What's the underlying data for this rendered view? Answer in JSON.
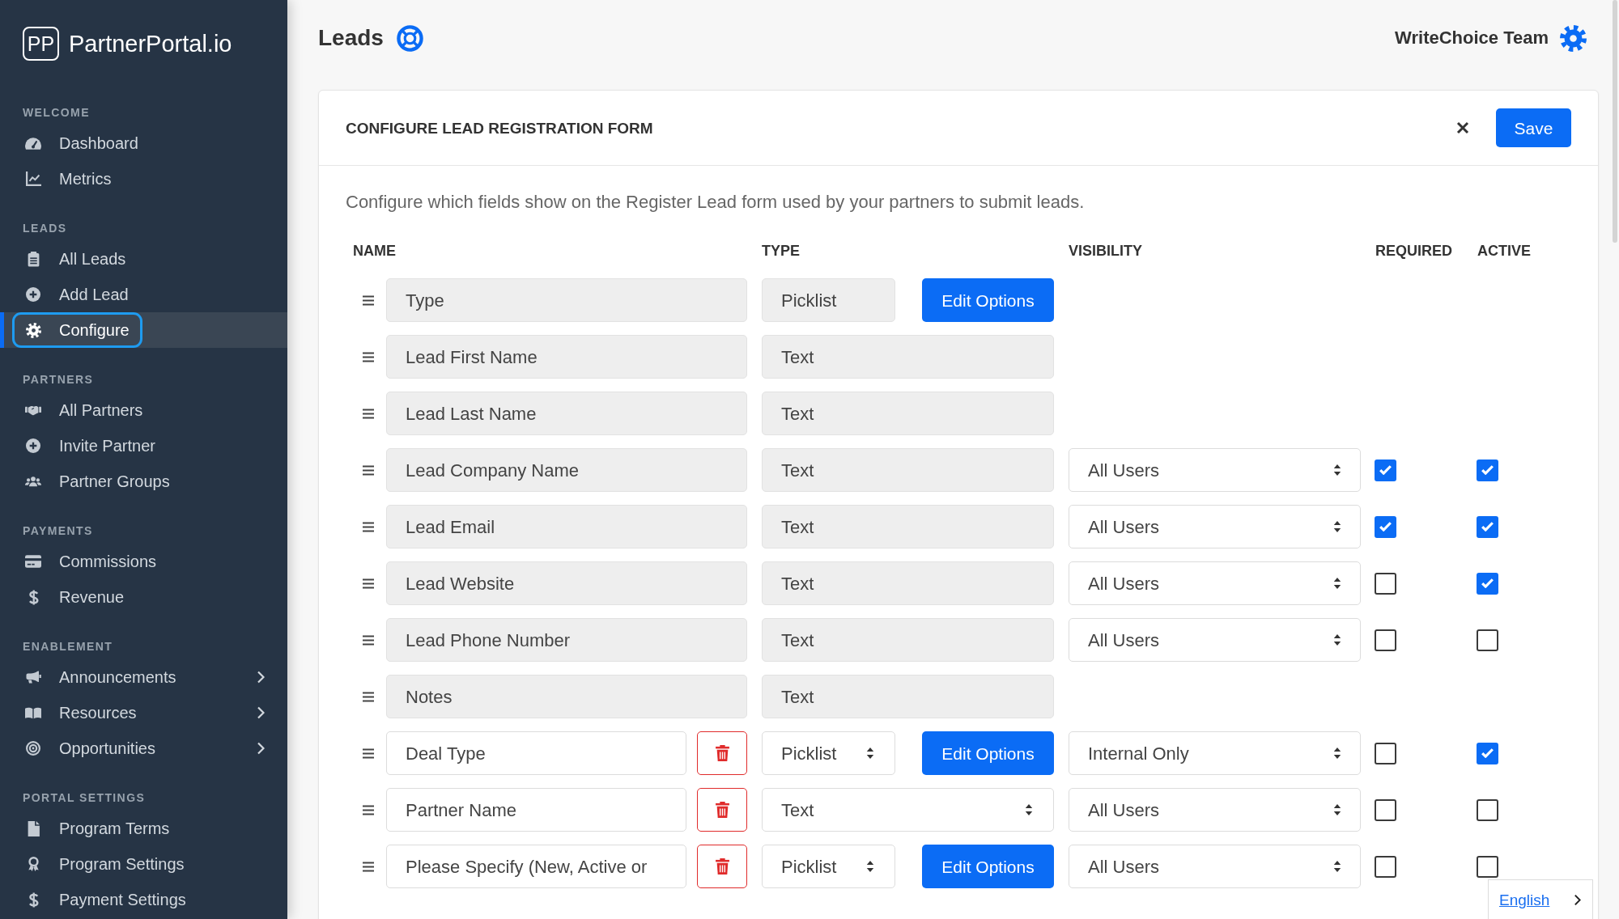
{
  "sidebar": {
    "logo": {
      "mark": "PP",
      "name": "PartnerPortal.io"
    },
    "sections": [
      {
        "title": "WELCOME",
        "items": [
          {
            "label": "Dashboard",
            "selected": false,
            "focused": false,
            "expandable": false
          },
          {
            "label": "Metrics",
            "selected": false,
            "focused": false,
            "expandable": false
          }
        ]
      },
      {
        "title": "LEADS",
        "items": [
          {
            "label": "All Leads",
            "selected": false,
            "focused": false,
            "expandable": false
          },
          {
            "label": "Add Lead",
            "selected": false,
            "focused": false,
            "expandable": false
          },
          {
            "label": "Configure",
            "selected": true,
            "focused": true,
            "expandable": false
          }
        ]
      },
      {
        "title": "PARTNERS",
        "items": [
          {
            "label": "All Partners",
            "selected": false,
            "focused": false,
            "expandable": false
          },
          {
            "label": "Invite Partner",
            "selected": false,
            "focused": false,
            "expandable": false
          },
          {
            "label": "Partner Groups",
            "selected": false,
            "focused": false,
            "expandable": false
          }
        ]
      },
      {
        "title": "PAYMENTS",
        "items": [
          {
            "label": "Commissions",
            "selected": false,
            "focused": false,
            "expandable": false
          },
          {
            "label": "Revenue",
            "selected": false,
            "focused": false,
            "expandable": false
          }
        ]
      },
      {
        "title": "ENABLEMENT",
        "items": [
          {
            "label": "Announcements",
            "selected": false,
            "focused": false,
            "expandable": true
          },
          {
            "label": "Resources",
            "selected": false,
            "focused": false,
            "expandable": true
          },
          {
            "label": "Opportunities",
            "selected": false,
            "focused": false,
            "expandable": true
          }
        ]
      },
      {
        "title": "PORTAL SETTINGS",
        "items": [
          {
            "label": "Program Terms",
            "selected": false,
            "focused": false,
            "expandable": false
          },
          {
            "label": "Program Settings",
            "selected": false,
            "focused": false,
            "expandable": false
          },
          {
            "label": "Payment Settings",
            "selected": false,
            "focused": false,
            "expandable": false
          }
        ]
      }
    ]
  },
  "header": {
    "title": "Leads",
    "user": "WriteChoice Team"
  },
  "panel": {
    "title": "CONFIGURE LEAD REGISTRATION FORM",
    "save_label": "Save",
    "description": "Configure which fields show on the Register Lead form used by your partners to submit leads.",
    "columns": [
      "NAME",
      "TYPE",
      "VISIBILITY",
      "REQUIRED",
      "ACTIVE"
    ],
    "fields": [
      {
        "name": "Type",
        "locked": true,
        "type": "Picklist",
        "options_button": "Edit Options"
      },
      {
        "name": "Lead First Name",
        "locked": true,
        "type": "Text"
      },
      {
        "name": "Lead Last Name",
        "locked": true,
        "type": "Text"
      },
      {
        "name": "Lead Company Name",
        "locked": true,
        "type": "Text",
        "visibility": "All Users",
        "required": true,
        "active": true
      },
      {
        "name": "Lead Email",
        "locked": true,
        "type": "Text",
        "visibility": "All Users",
        "required": true,
        "active": true
      },
      {
        "name": "Lead Website",
        "locked": true,
        "type": "Text",
        "visibility": "All Users",
        "required": false,
        "active": true
      },
      {
        "name": "Lead Phone Number",
        "locked": true,
        "type": "Text",
        "visibility": "All Users",
        "required": false,
        "active": false
      },
      {
        "name": "Notes",
        "locked": true,
        "type": "Text"
      },
      {
        "name": "Deal Type",
        "locked": false,
        "type": "Picklist",
        "options_button": "Edit Options",
        "visibility": "Internal Only",
        "required": false,
        "active": true
      },
      {
        "name": "Partner Name",
        "locked": false,
        "type": "Text",
        "visibility": "All Users",
        "required": false,
        "active": false
      },
      {
        "name": "Please Specify (New, Active or",
        "locked": false,
        "type": "Picklist",
        "options_button": "Edit Options",
        "visibility": "All Users",
        "required": false,
        "active": false
      }
    ]
  },
  "language": {
    "label": "English"
  }
}
